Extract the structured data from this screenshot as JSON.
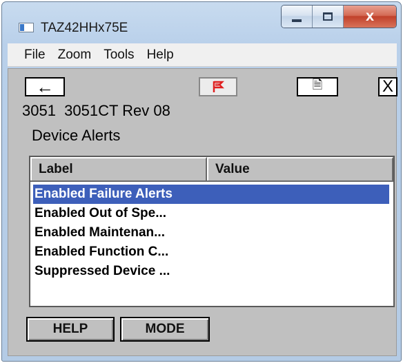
{
  "window": {
    "title": "TAZ42HHx75E",
    "caption_buttons": {
      "minimize_icon": "minimize-icon",
      "maximize_icon": "maximize-icon",
      "close_glyph": "X"
    }
  },
  "menu": [
    "File",
    "Zoom",
    "Tools",
    "Help"
  ],
  "toolbar": {
    "back_glyph": "←",
    "doc_glyph": "🗎",
    "close_glyph": "X",
    "flag_icon": "hart-flag-icon",
    "flag_color": "#e02020"
  },
  "device": {
    "line": "3051  3051CT Rev 08",
    "section": "Device Alerts"
  },
  "table": {
    "columns": [
      "Label",
      "Value"
    ],
    "rows": [
      {
        "label": "Enabled Failure Alerts",
        "value": "",
        "selected": true
      },
      {
        "label": "Enabled Out of Spe...",
        "value": "",
        "selected": false
      },
      {
        "label": "Enabled Maintenan...",
        "value": "",
        "selected": false
      },
      {
        "label": "Enabled Function C...",
        "value": "",
        "selected": false
      },
      {
        "label": "Suppressed Device ...",
        "value": "",
        "selected": false
      }
    ],
    "selection_color": "#3d5fba"
  },
  "buttons": {
    "help": "HELP",
    "mode": "MODE"
  }
}
